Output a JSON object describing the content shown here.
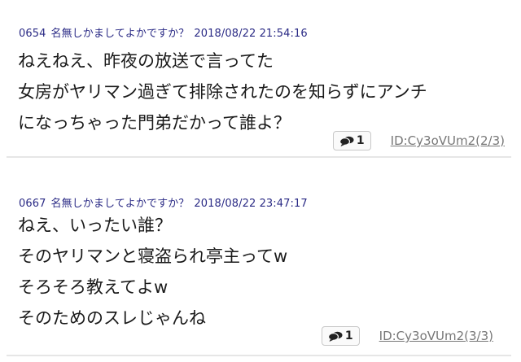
{
  "posts": [
    {
      "number": "0654",
      "name": "名無しかましてよかですか？",
      "datetime": "2018/08/22 21:54:16",
      "lines": [
        "ねえねえ、昨夜の放送で言ってた",
        "女房がヤリマン過ぎて排除されたのを知らずにアンチ",
        "になっちゃった門弟だかって誰よ？"
      ],
      "reply_count": "1",
      "id_text": "ID:Cy3oVUm2(2/3)"
    },
    {
      "number": "0667",
      "name": "名無しかましてよかですか？",
      "datetime": "2018/08/22 23:47:17",
      "lines": [
        "ねえ、いったい誰？",
        "そのヤリマンと寝盗られ亭主ってw",
        "そろそろ教えてよw",
        "そのためのスレじゃんね"
      ],
      "reply_count": "1",
      "id_text": "ID:Cy3oVUm2(3/3)"
    }
  ],
  "icons": {
    "reply": "speech-bubbles-icon"
  },
  "colors": {
    "meta": "#2a2a85",
    "body_text": "#1a1a1a",
    "id_link": "#777777",
    "divider": "#e6e6e6"
  }
}
